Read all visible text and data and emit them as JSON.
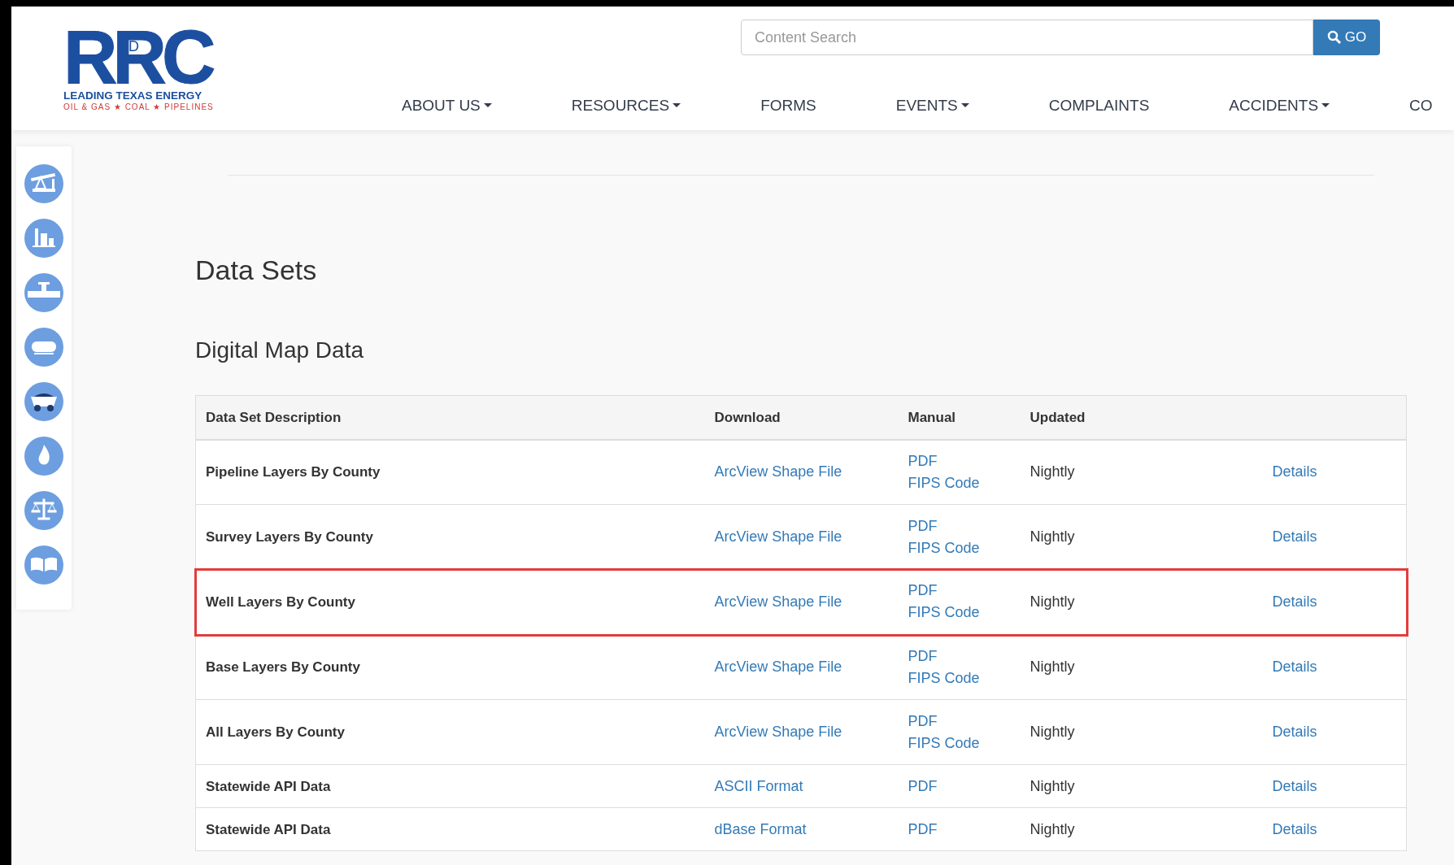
{
  "logo": {
    "mark": "RRC",
    "small": "D",
    "tagline": "LEADING TEXAS ENERGY",
    "subline": "OIL & GAS ★ COAL ★ PIPELINES"
  },
  "search": {
    "placeholder": "Content Search",
    "button": "GO"
  },
  "nav": [
    {
      "label": "ABOUT US",
      "caret": true
    },
    {
      "label": "RESOURCES",
      "caret": true
    },
    {
      "label": "FORMS",
      "caret": false
    },
    {
      "label": "EVENTS",
      "caret": true
    },
    {
      "label": "COMPLAINTS",
      "caret": false
    },
    {
      "label": "ACCIDENTS",
      "caret": true
    },
    {
      "label": "CO",
      "caret": false
    }
  ],
  "sidebar": {
    "items": [
      {
        "kind": "pumpjack"
      },
      {
        "kind": "refinery"
      },
      {
        "kind": "pipeline"
      },
      {
        "kind": "tank"
      },
      {
        "kind": "truck"
      },
      {
        "kind": "flame"
      },
      {
        "kind": "scales"
      },
      {
        "kind": "book"
      }
    ]
  },
  "page_title": "Data Sets",
  "section_title": "Digital Map Data",
  "table": {
    "columns": [
      "Data Set Description",
      "Download",
      "Manual",
      "Updated"
    ],
    "rows": [
      {
        "description": "Pipeline Layers By County",
        "download": "ArcView Shape File",
        "manual": [
          "PDF",
          "FIPS Code"
        ],
        "updated": "Nightly",
        "details": "Details",
        "highlighted": false
      },
      {
        "description": "Survey Layers By County",
        "download": "ArcView Shape File",
        "manual": [
          "PDF",
          "FIPS Code"
        ],
        "updated": "Nightly",
        "details": "Details",
        "highlighted": false
      },
      {
        "description": "Well Layers By County",
        "download": "ArcView Shape File",
        "manual": [
          "PDF",
          "FIPS Code"
        ],
        "updated": "Nightly",
        "details": "Details",
        "highlighted": true
      },
      {
        "description": "Base Layers By County",
        "download": "ArcView Shape File",
        "manual": [
          "PDF",
          "FIPS Code"
        ],
        "updated": "Nightly",
        "details": "Details",
        "highlighted": false
      },
      {
        "description": "All Layers By County",
        "download": "ArcView Shape File",
        "manual": [
          "PDF",
          "FIPS Code"
        ],
        "updated": "Nightly",
        "details": "Details",
        "highlighted": false
      },
      {
        "description": "Statewide API Data",
        "download": "ASCII Format",
        "manual": [
          "PDF"
        ],
        "updated": "Nightly",
        "details": "Details",
        "highlighted": false
      },
      {
        "description": "Statewide API Data",
        "download": "dBase Format",
        "manual": [
          "PDF"
        ],
        "updated": "Nightly",
        "details": "Details",
        "highlighted": false
      }
    ]
  }
}
